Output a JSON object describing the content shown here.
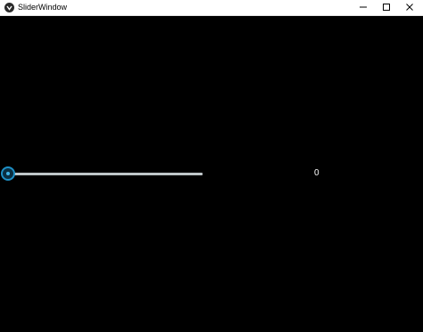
{
  "window": {
    "title": "SliderWindow",
    "controls": {
      "minimize_icon": "minimize-icon",
      "maximize_icon": "maximize-icon",
      "close_icon": "close-icon"
    }
  },
  "slider": {
    "value": 0,
    "value_label": "0",
    "accent_color": "#1e8fc5",
    "track_color": "#bfc6c9"
  },
  "colors": {
    "background": "#000000",
    "titlebar": "#ffffff",
    "text": "#ffffff"
  }
}
